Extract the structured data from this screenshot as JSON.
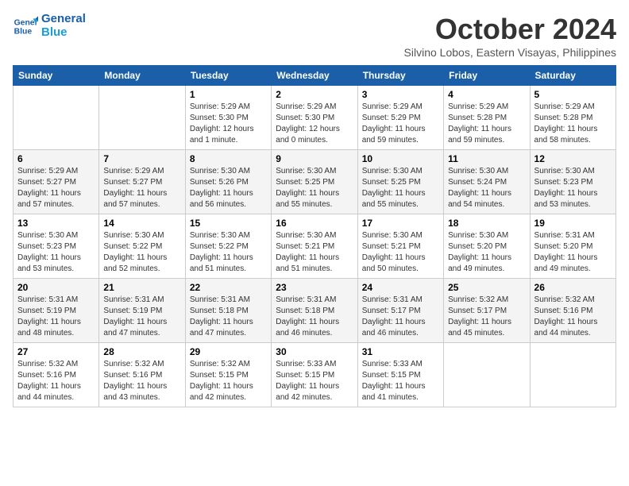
{
  "header": {
    "logo_line1": "General",
    "logo_line2": "Blue",
    "month": "October 2024",
    "location": "Silvino Lobos, Eastern Visayas, Philippines"
  },
  "weekdays": [
    "Sunday",
    "Monday",
    "Tuesday",
    "Wednesday",
    "Thursday",
    "Friday",
    "Saturday"
  ],
  "weeks": [
    [
      {
        "day": "",
        "content": ""
      },
      {
        "day": "",
        "content": ""
      },
      {
        "day": "1",
        "content": "Sunrise: 5:29 AM\nSunset: 5:30 PM\nDaylight: 12 hours\nand 1 minute."
      },
      {
        "day": "2",
        "content": "Sunrise: 5:29 AM\nSunset: 5:30 PM\nDaylight: 12 hours\nand 0 minutes."
      },
      {
        "day": "3",
        "content": "Sunrise: 5:29 AM\nSunset: 5:29 PM\nDaylight: 11 hours\nand 59 minutes."
      },
      {
        "day": "4",
        "content": "Sunrise: 5:29 AM\nSunset: 5:28 PM\nDaylight: 11 hours\nand 59 minutes."
      },
      {
        "day": "5",
        "content": "Sunrise: 5:29 AM\nSunset: 5:28 PM\nDaylight: 11 hours\nand 58 minutes."
      }
    ],
    [
      {
        "day": "6",
        "content": "Sunrise: 5:29 AM\nSunset: 5:27 PM\nDaylight: 11 hours\nand 57 minutes."
      },
      {
        "day": "7",
        "content": "Sunrise: 5:29 AM\nSunset: 5:27 PM\nDaylight: 11 hours\nand 57 minutes."
      },
      {
        "day": "8",
        "content": "Sunrise: 5:30 AM\nSunset: 5:26 PM\nDaylight: 11 hours\nand 56 minutes."
      },
      {
        "day": "9",
        "content": "Sunrise: 5:30 AM\nSunset: 5:25 PM\nDaylight: 11 hours\nand 55 minutes."
      },
      {
        "day": "10",
        "content": "Sunrise: 5:30 AM\nSunset: 5:25 PM\nDaylight: 11 hours\nand 55 minutes."
      },
      {
        "day": "11",
        "content": "Sunrise: 5:30 AM\nSunset: 5:24 PM\nDaylight: 11 hours\nand 54 minutes."
      },
      {
        "day": "12",
        "content": "Sunrise: 5:30 AM\nSunset: 5:23 PM\nDaylight: 11 hours\nand 53 minutes."
      }
    ],
    [
      {
        "day": "13",
        "content": "Sunrise: 5:30 AM\nSunset: 5:23 PM\nDaylight: 11 hours\nand 53 minutes."
      },
      {
        "day": "14",
        "content": "Sunrise: 5:30 AM\nSunset: 5:22 PM\nDaylight: 11 hours\nand 52 minutes."
      },
      {
        "day": "15",
        "content": "Sunrise: 5:30 AM\nSunset: 5:22 PM\nDaylight: 11 hours\nand 51 minutes."
      },
      {
        "day": "16",
        "content": "Sunrise: 5:30 AM\nSunset: 5:21 PM\nDaylight: 11 hours\nand 51 minutes."
      },
      {
        "day": "17",
        "content": "Sunrise: 5:30 AM\nSunset: 5:21 PM\nDaylight: 11 hours\nand 50 minutes."
      },
      {
        "day": "18",
        "content": "Sunrise: 5:30 AM\nSunset: 5:20 PM\nDaylight: 11 hours\nand 49 minutes."
      },
      {
        "day": "19",
        "content": "Sunrise: 5:31 AM\nSunset: 5:20 PM\nDaylight: 11 hours\nand 49 minutes."
      }
    ],
    [
      {
        "day": "20",
        "content": "Sunrise: 5:31 AM\nSunset: 5:19 PM\nDaylight: 11 hours\nand 48 minutes."
      },
      {
        "day": "21",
        "content": "Sunrise: 5:31 AM\nSunset: 5:19 PM\nDaylight: 11 hours\nand 47 minutes."
      },
      {
        "day": "22",
        "content": "Sunrise: 5:31 AM\nSunset: 5:18 PM\nDaylight: 11 hours\nand 47 minutes."
      },
      {
        "day": "23",
        "content": "Sunrise: 5:31 AM\nSunset: 5:18 PM\nDaylight: 11 hours\nand 46 minutes."
      },
      {
        "day": "24",
        "content": "Sunrise: 5:31 AM\nSunset: 5:17 PM\nDaylight: 11 hours\nand 46 minutes."
      },
      {
        "day": "25",
        "content": "Sunrise: 5:32 AM\nSunset: 5:17 PM\nDaylight: 11 hours\nand 45 minutes."
      },
      {
        "day": "26",
        "content": "Sunrise: 5:32 AM\nSunset: 5:16 PM\nDaylight: 11 hours\nand 44 minutes."
      }
    ],
    [
      {
        "day": "27",
        "content": "Sunrise: 5:32 AM\nSunset: 5:16 PM\nDaylight: 11 hours\nand 44 minutes."
      },
      {
        "day": "28",
        "content": "Sunrise: 5:32 AM\nSunset: 5:16 PM\nDaylight: 11 hours\nand 43 minutes."
      },
      {
        "day": "29",
        "content": "Sunrise: 5:32 AM\nSunset: 5:15 PM\nDaylight: 11 hours\nand 42 minutes."
      },
      {
        "day": "30",
        "content": "Sunrise: 5:33 AM\nSunset: 5:15 PM\nDaylight: 11 hours\nand 42 minutes."
      },
      {
        "day": "31",
        "content": "Sunrise: 5:33 AM\nSunset: 5:15 PM\nDaylight: 11 hours\nand 41 minutes."
      },
      {
        "day": "",
        "content": ""
      },
      {
        "day": "",
        "content": ""
      }
    ]
  ]
}
